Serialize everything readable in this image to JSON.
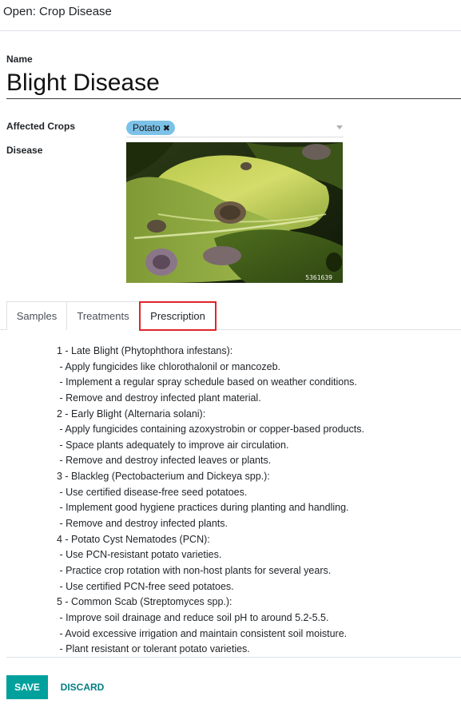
{
  "dialog": {
    "title": "Open: Crop Disease"
  },
  "form": {
    "name_label": "Name",
    "name_value": "Blight Disease",
    "affected_crops_label": "Affected Crops",
    "affected_crops_tags": [
      {
        "label": "Potato",
        "remove_glyph": "✖"
      }
    ],
    "disease_label": "Disease",
    "disease_image": {
      "caption_id": "5361639",
      "icon": "blighted-leaf-photo"
    }
  },
  "tabs": [
    {
      "label": "Samples",
      "active": false
    },
    {
      "label": "Treatments",
      "active": false
    },
    {
      "label": "Prescription",
      "active": true
    }
  ],
  "prescription_lines": [
    "1 - Late Blight (Phytophthora infestans):",
    " - Apply fungicides like chlorothalonil or mancozeb.",
    " - Implement a regular spray schedule based on weather conditions.",
    " - Remove and destroy infected plant material.",
    "2 - Early Blight (Alternaria solani):",
    " - Apply fungicides containing azoxystrobin or copper-based products.",
    " - Space plants adequately to improve air circulation.",
    " - Remove and destroy infected leaves or plants.",
    "3 - Blackleg (Pectobacterium and Dickeya spp.):",
    " - Use certified disease-free seed potatoes.",
    " - Implement good hygiene practices during planting and handling.",
    " - Remove and destroy infected plants.",
    "4 - Potato Cyst Nematodes (PCN):",
    " - Use PCN-resistant potato varieties.",
    " - Practice crop rotation with non-host plants for several years.",
    " - Use certified PCN-free seed potatoes.",
    "5 - Common Scab (Streptomyces spp.):",
    " - Improve soil drainage and reduce soil pH to around 5.2-5.5.",
    " - Avoid excessive irrigation and maintain consistent soil moisture.",
    " - Plant resistant or tolerant potato varieties."
  ],
  "footer": {
    "save_label": "SAVE",
    "discard_label": "DISCARD"
  },
  "colors": {
    "accent": "#00a09d",
    "tag_bg": "#7cc2e8",
    "highlight_border": "#e0242b"
  }
}
